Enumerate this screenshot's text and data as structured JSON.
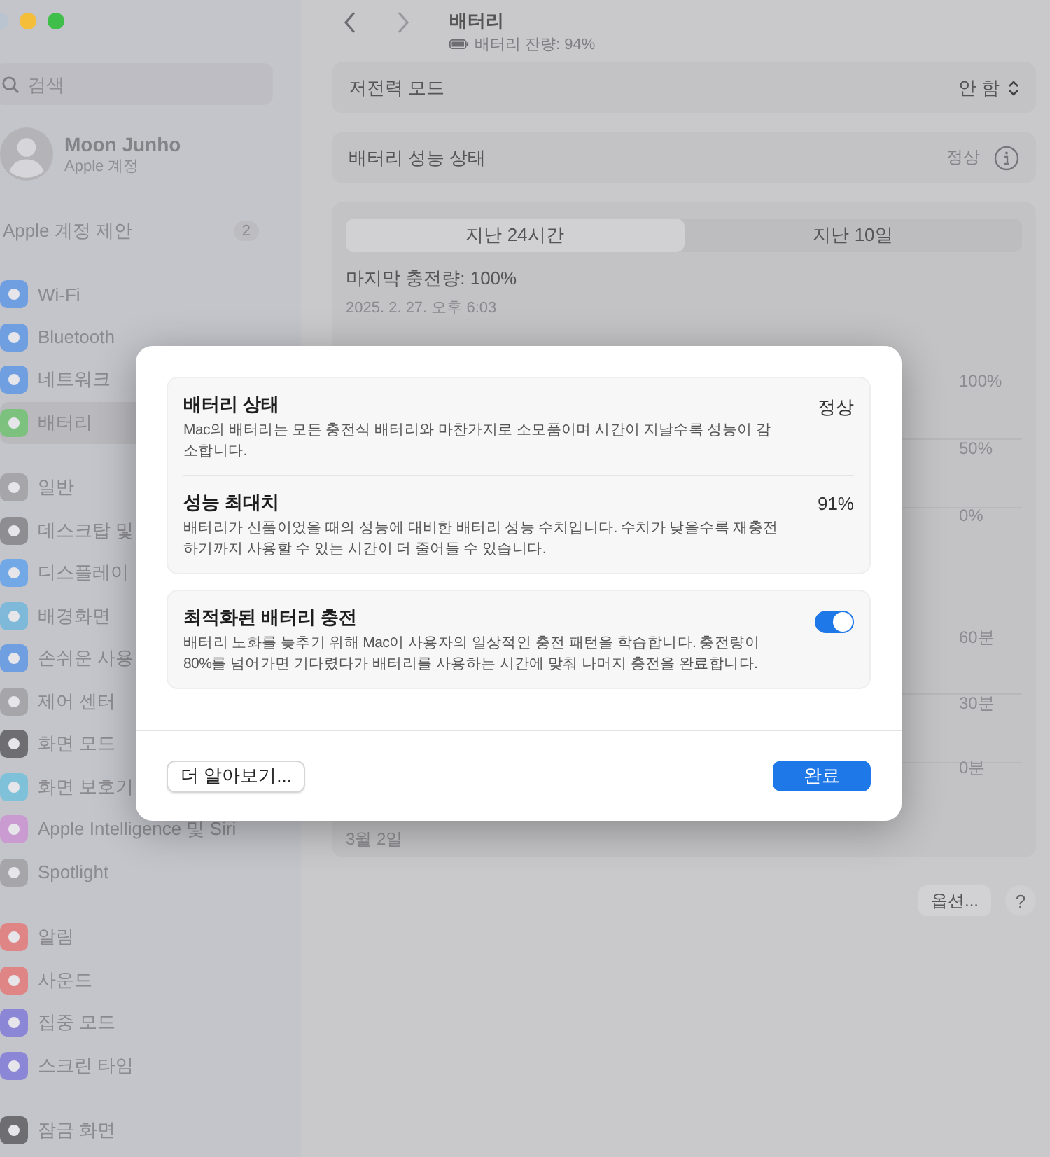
{
  "sidebar": {
    "search": {
      "placeholder": "검색"
    },
    "account": {
      "name": "Moon Junho",
      "subtitle": "Apple 계정"
    },
    "suggestion": {
      "label": "Apple 계정 제안",
      "badge": "2"
    },
    "sections": [
      [
        {
          "label": "Wi-Fi",
          "selected": false,
          "color": "#6f9fe0"
        },
        {
          "label": "Bluetooth",
          "selected": false,
          "color": "#6f9fe0"
        },
        {
          "label": "네트워크",
          "selected": false,
          "color": "#6f9fe0"
        },
        {
          "label": "배터리",
          "selected": true,
          "color": "#7cc27e"
        }
      ],
      [
        {
          "label": "일반",
          "selected": false,
          "color": "#a6a6aa"
        },
        {
          "label": "데스크탑 및",
          "selected": false,
          "color": "#8d8d92"
        },
        {
          "label": "디스플레이",
          "selected": false,
          "color": "#72a8e6"
        },
        {
          "label": "배경화면",
          "selected": false,
          "color": "#7fb9d9"
        },
        {
          "label": "손쉬운 사용",
          "selected": false,
          "color": "#6f9fe0"
        },
        {
          "label": "제어 센터",
          "selected": false,
          "color": "#a6a6aa"
        },
        {
          "label": "화면 모드",
          "selected": false,
          "color": "#6e6e72"
        },
        {
          "label": "화면 보호기",
          "selected": false,
          "color": "#7fc1d8"
        },
        {
          "label": "Apple Intelligence 및 Siri",
          "selected": false,
          "color": "#c99bd0"
        },
        {
          "label": "Spotlight",
          "selected": false,
          "color": "#a6a6aa"
        }
      ],
      [
        {
          "label": "알림",
          "selected": false,
          "color": "#e08585"
        },
        {
          "label": "사운드",
          "selected": false,
          "color": "#e08585"
        },
        {
          "label": "집중 모드",
          "selected": false,
          "color": "#8c86d6"
        },
        {
          "label": "스크린 타임",
          "selected": false,
          "color": "#8c86d6"
        }
      ],
      [
        {
          "label": "잠금 화면",
          "selected": false,
          "color": "#6e6e72"
        }
      ]
    ]
  },
  "main": {
    "title": "배터리",
    "subtitle": "배터리 잔량: 94%",
    "rows": [
      {
        "kind": "popup",
        "label": "저전력 모드",
        "value": "안 함"
      },
      {
        "kind": "info",
        "label": "배터리 성능 상태",
        "value": "정상"
      }
    ],
    "usage": {
      "tabs": [
        {
          "label": "지난 24시간",
          "selected": true
        },
        {
          "label": "지난 10일",
          "selected": false
        }
      ],
      "last_charge": "마지막 충전량: 100%",
      "last_charge_time": "2025. 2. 27. 오후 6:03",
      "level_axis": [
        "100%",
        "50%",
        "0%"
      ],
      "time_axis": [
        "60분",
        "30분",
        "0분"
      ],
      "date_label": "3월 2일"
    },
    "options_button": "옵션...",
    "help_button": "?"
  },
  "dialog": {
    "groups": [
      [
        {
          "kind": "value",
          "title": "배터리 상태",
          "value": "정상",
          "description": "Mac의 배터리는 모든 충전식 배터리와 마찬가지로 소모품이며 시간이 지날수록 성능이 감소합니다."
        },
        {
          "kind": "value",
          "title": "성능 최대치",
          "value": "91%",
          "description": "배터리가 신품이었을 때의 성능에 대비한 배터리 성능 수치입니다. 수치가 낮을수록 재충전하기까지 사용할 수 있는 시간이 더 줄어들 수 있습니다."
        }
      ],
      [
        {
          "kind": "toggle",
          "title": "최적화된 배터리 충전",
          "on": true,
          "description": "배터리 노화를 늦추기 위해 Mac이 사용자의 일상적인 충전 패턴을 학습합니다. 충전량이 80%를 넘어가면 기다렸다가 배터리를 사용하는 시간에 맞춰 나머지 충전을 완료합니다."
        }
      ]
    ],
    "learn_more": "더 알아보기...",
    "done": "완료"
  }
}
